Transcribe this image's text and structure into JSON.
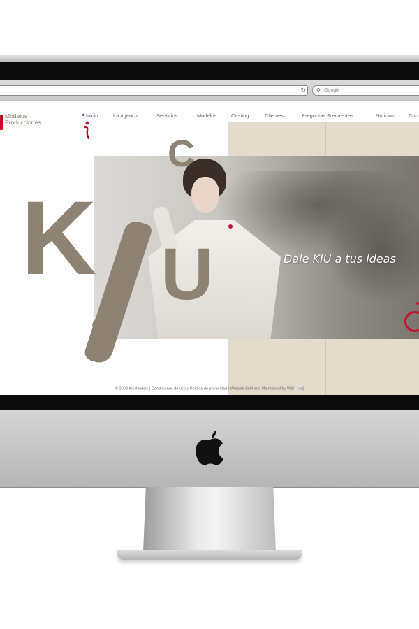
{
  "browser": {
    "search_placeholder": "Google",
    "search_icon": "search-icon",
    "reload_icon": "reload-icon"
  },
  "site": {
    "logo": {
      "line1": "Modelos",
      "line2": "Producciones"
    },
    "nav": [
      {
        "label": "Inicio"
      },
      {
        "label": "La agencia"
      },
      {
        "label": "Servicios"
      },
      {
        "label": "Modelos"
      },
      {
        "label": "Casting"
      },
      {
        "label": "Clientes"
      },
      {
        "label": "Preguntas Frecuentes"
      },
      {
        "label": "Noticias"
      },
      {
        "label": "Con"
      }
    ],
    "hero": {
      "letters": {
        "k": "K",
        "c": "C",
        "u": "U"
      },
      "tagline": "Dale KIU a tus ideas"
    },
    "footer": "© 2008 Kiu Models | Condiciones de uso y Política de privacidad | Website Built and Maintained by WSI"
  },
  "colors": {
    "brand_red": "#c8102e",
    "brand_taupe": "#8e8272",
    "stripe": "#e3dbcc"
  },
  "device": {
    "logo_icon": "apple-logo-icon"
  }
}
